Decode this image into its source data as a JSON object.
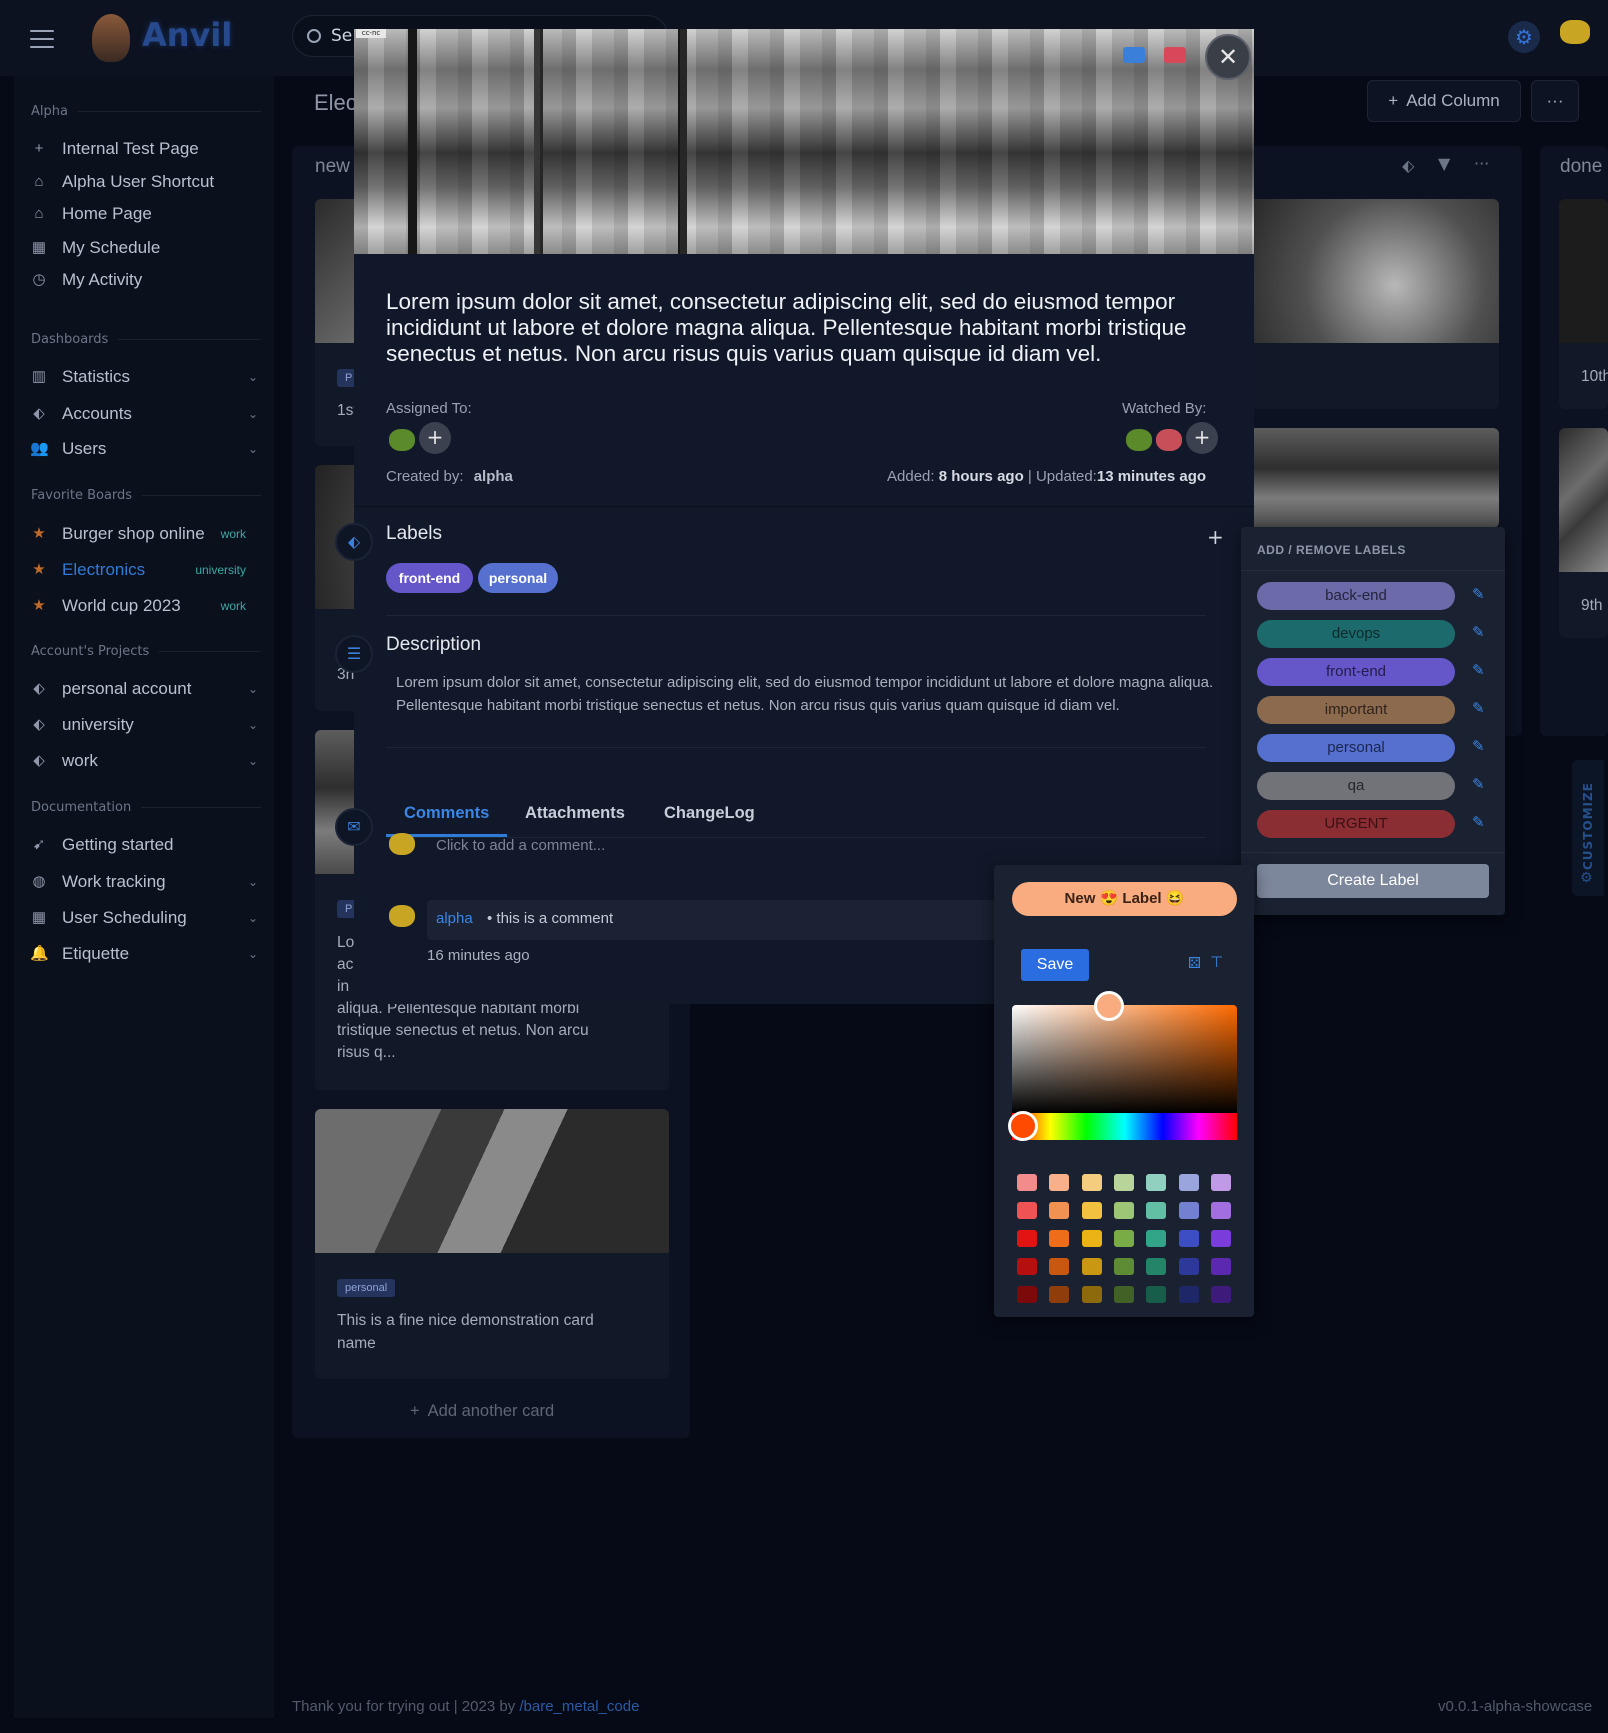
{
  "app": {
    "name": "Anvil",
    "search_placeholder": "Se"
  },
  "sidebar": {
    "sections": [
      {
        "title": "Alpha",
        "items": [
          {
            "label": "Internal Test Page",
            "icon": "plus-icon"
          },
          {
            "label": "Alpha User Shortcut",
            "icon": "house-user-icon"
          },
          {
            "label": "Home Page",
            "icon": "home-icon"
          },
          {
            "label": "My Schedule",
            "icon": "calendar-icon"
          },
          {
            "label": "My Activity",
            "icon": "clock-icon"
          }
        ]
      },
      {
        "title": "Dashboards",
        "items": [
          {
            "label": "Statistics",
            "icon": "chart-icon"
          },
          {
            "label": "Accounts",
            "icon": "tags-icon"
          },
          {
            "label": "Users",
            "icon": "users-icon"
          }
        ]
      },
      {
        "title": "Favorite Boards",
        "items": [
          {
            "label": "Burger shop online",
            "tag": "work"
          },
          {
            "label": "Electronics",
            "tag": "university"
          },
          {
            "label": "World cup 2023",
            "tag": "work"
          }
        ]
      },
      {
        "title": "Account's Projects",
        "items": [
          {
            "label": "personal account"
          },
          {
            "label": "university"
          },
          {
            "label": "work"
          }
        ]
      },
      {
        "title": "Documentation",
        "items": [
          {
            "label": "Getting started"
          },
          {
            "label": "Work tracking"
          },
          {
            "label": "User Scheduling"
          },
          {
            "label": "Etiquette"
          }
        ]
      }
    ]
  },
  "board": {
    "title": "Elec",
    "add_column": "Add Column",
    "more": "···",
    "columns": [
      {
        "title": "new"
      },
      {
        "title": "done"
      }
    ],
    "cards": {
      "c1_tag": "P",
      "c1_text": "1st",
      "c2_text": "3n",
      "c3_tag": "P",
      "c3_text_lines": [
        "Lo",
        "ac",
        "in",
        "aliqua. Pellentesque habitant morbi",
        "tristique senectus et netus. Non arcu",
        "risus q..."
      ],
      "c4_tag": "personal",
      "c4_text_lines": [
        "This is a fine nice demonstration card",
        "name"
      ],
      "right_c1_text": "10th",
      "right_c2_text": "9th"
    },
    "add_card": "Add another card"
  },
  "modal": {
    "cc_badge": "cc-nc",
    "title": "Lorem ipsum dolor sit amet, consectetur adipiscing elit, sed do eiusmod tempor incididunt ut labore et dolore magna aliqua. Pellentesque habitant morbi tristique senectus et netus. Non arcu risus quis varius quam quisque id diam vel.",
    "assigned_to": "Assigned To:",
    "watched_by": "Watched By:",
    "created_by_label": "Created by:",
    "created_by": "alpha",
    "added_label": "Added:",
    "added_value": "8 hours ago",
    "updated_label": "Updated:",
    "updated_value": "13 minutes ago",
    "labels_heading": "Labels",
    "labels": [
      {
        "name": "front-end",
        "color": "#6557c9"
      },
      {
        "name": "personal",
        "color": "#5570cf"
      }
    ],
    "description_heading": "Description",
    "description": "Lorem ipsum dolor sit amet, consectetur adipiscing elit, sed do eiusmod tempor incididunt ut labore et dolore magna aliqua. Pellentesque habitant morbi tristique senectus et netus. Non arcu risus quis varius quam quisque id diam vel.",
    "tabs": [
      "Comments",
      "Attachments",
      "ChangeLog"
    ],
    "comment_placeholder": "Click to add a comment...",
    "comment": {
      "author": "alpha",
      "text": "• this is a comment",
      "time": "16 minutes ago"
    }
  },
  "labels_panel": {
    "heading": "ADD / REMOVE LABELS",
    "labels": [
      {
        "name": "back-end",
        "color": "#6c6aa8"
      },
      {
        "name": "devops",
        "color": "#1d6a6d"
      },
      {
        "name": "front-end",
        "color": "#6557c9"
      },
      {
        "name": "important",
        "color": "#8c6a4e"
      },
      {
        "name": "personal",
        "color": "#5570cf"
      },
      {
        "name": "qa",
        "color": "#717378"
      },
      {
        "name": "URGENT",
        "color": "#8b2e34"
      }
    ],
    "create_button": "Create Label"
  },
  "picker": {
    "new_label": "New 😍 Label 😆",
    "save": "Save",
    "swatches": [
      [
        "#f28b8b",
        "#f8b08a",
        "#f4cd7f",
        "#b9d49a",
        "#8fd0c0",
        "#9ba5dd",
        "#c09ae6"
      ],
      [
        "#ef5353",
        "#f09352",
        "#f1c13f",
        "#9dc576",
        "#62bfa5",
        "#7381d2",
        "#a36ee0"
      ],
      [
        "#e11313",
        "#ed6d1a",
        "#eab416",
        "#79ac46",
        "#32a588",
        "#3d4ec4",
        "#7a3ddb"
      ],
      [
        "#b50f0f",
        "#c8570f",
        "#c99711",
        "#5e8c34",
        "#238468",
        "#2c399a",
        "#5c28b0"
      ],
      [
        "#7d0a0a",
        "#8f3d0b",
        "#8d6a0c",
        "#416126",
        "#185d49",
        "#1e2868",
        "#3e1b7a"
      ]
    ]
  },
  "customize_label": "CUSTOMIZE",
  "footer": {
    "left": "Thank you for trying out | 2023 by ",
    "link": "/bare_metal_code",
    "right": "v0.0.1-alpha-showcase"
  }
}
